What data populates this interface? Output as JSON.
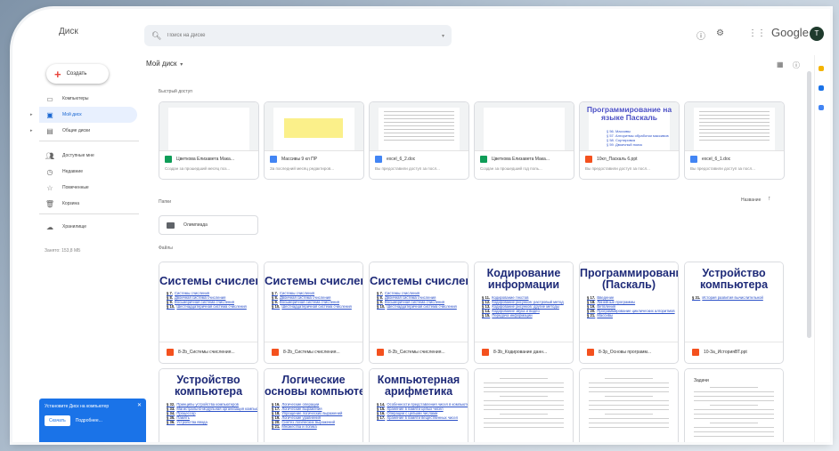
{
  "app": {
    "name": "Диск",
    "brand": "Google",
    "avatar_initial": "Т"
  },
  "search": {
    "placeholder": "Поиск на Диске"
  },
  "colors": {
    "accent": "#1a73e8",
    "active_bg": "#e8f0fe",
    "create_plus": "#e8453c"
  },
  "sidebar": {
    "create_label": "Создать",
    "items": [
      {
        "label": "Компьютеры",
        "icon": "devices-icon",
        "caret": false,
        "active": false
      },
      {
        "label": "Мой диск",
        "icon": "my-drive-icon",
        "caret": true,
        "active": true
      },
      {
        "label": "Общие диски",
        "icon": "shared-drives-icon",
        "caret": true,
        "active": false
      },
      {
        "label": "Доступные мне",
        "icon": "shared-with-me-icon",
        "caret": false,
        "active": false
      },
      {
        "label": "Недавние",
        "icon": "clock-icon",
        "caret": false,
        "active": false
      },
      {
        "label": "Помеченные",
        "icon": "star-icon",
        "caret": false,
        "active": false
      },
      {
        "label": "Корзина",
        "icon": "trash-icon",
        "caret": false,
        "active": false
      },
      {
        "label": "Хранилище",
        "icon": "cloud-icon",
        "caret": false,
        "active": false
      }
    ],
    "storage_text": "Занято: 153,8 МБ"
  },
  "install_banner": {
    "title": "Установите Диск на компьютер",
    "primary": "Скачать",
    "secondary": "Подробнее...",
    "close": "✕"
  },
  "main": {
    "breadcrumb": "Мой диск",
    "quick_access_label": "Быстрый доступ",
    "folders_label": "Папки",
    "files_label": "Файлы",
    "sort_label": "Название",
    "sort_arrow": "↑",
    "quick_access": [
      {
        "name": "Цветкова Елизавета Мака...",
        "sub": "Создан за прошедший месяц поз...",
        "type": "sheet",
        "thumb": "blank"
      },
      {
        "name": "Массивы 9 кл ПР",
        "sub": "За последний месяц редактиров...",
        "type": "doc",
        "thumb": "yellow"
      },
      {
        "name": "excel_6_2.doc",
        "sub": "Вы предоставили доступ за посл...",
        "type": "doc",
        "thumb": "lines"
      },
      {
        "name": "Цветкова Елизавета Мака...",
        "sub": "Создан за прошедший год поль...",
        "type": "sheet",
        "thumb": "blank"
      },
      {
        "name": "10кл_Паскаль 6.ppt",
        "sub": "Вы предоставили доступ за посл...",
        "type": "slide",
        "thumb": "pascal",
        "thumb_title": "Программирование на языке Паскаль",
        "thumb_links": [
          "§ 56. Массивы",
          "§ 57. Алгоритмы обработки массивов",
          "§ 58. Сортировка",
          "§ 59. Двоичный поиск"
        ]
      },
      {
        "name": "excel_6_1.doc",
        "sub": "Вы предоставили доступ за посл...",
        "type": "doc",
        "thumb": "lines"
      }
    ],
    "folders": [
      {
        "name": "Олимпиада"
      }
    ],
    "files": [
      {
        "title": "Системы счисления",
        "name": "8-2b_Системы счисления...",
        "type": "slide",
        "links": [
          [
            "§ 7.",
            "Системы счисления"
          ],
          [
            "§ 8.",
            "Двоичная система счисления"
          ],
          [
            "§ 9.",
            "Восьмеричная система счисления"
          ],
          [
            "§ 10.",
            "Шестнадцатеричная система счисления"
          ]
        ]
      },
      {
        "title": "Системы счисления",
        "name": "8-2b_Системы счисления...",
        "type": "slide",
        "links": [
          [
            "§ 7.",
            "Системы счисления"
          ],
          [
            "§ 8.",
            "Двоичная система счисления"
          ],
          [
            "§ 9.",
            "Восьмеричная система счисления"
          ],
          [
            "§ 10.",
            "Шестнадцатеричная система счисления"
          ]
        ]
      },
      {
        "title": "Системы счисления",
        "name": "8-2b_Системы счисления...",
        "type": "slide",
        "links": [
          [
            "§ 7.",
            "Системы счисления"
          ],
          [
            "§ 8.",
            "Двоичная система счисления"
          ],
          [
            "§ 9.",
            "Восьмеричная система счисления"
          ],
          [
            "§ 10.",
            "Шестнадцатеричная система счисления"
          ]
        ]
      },
      {
        "title": "Кодирование информации",
        "name": "8-3b_Кодирование данн...",
        "type": "slide",
        "links": [
          [
            "§ 11.",
            "Кодирование текстов"
          ],
          [
            "§ 12.",
            "Кодирование рисунков: растровый метод"
          ],
          [
            "§ 13.",
            "Кодирование рисунков: другие методы"
          ],
          [
            "§ 14.",
            "Кодирование звука и видео"
          ],
          [
            "§ 15.",
            "Передача информации"
          ]
        ]
      },
      {
        "title": "Программирование (Паскаль)",
        "name": "8-3p_Основы программ...",
        "type": "slide",
        "links": [
          [
            "§ 17.",
            "Введение"
          ],
          [
            "§ 18.",
            "Линейные программы"
          ],
          [
            "§ 19.",
            "Ветвления"
          ],
          [
            "§ 20.",
            "Программирование циклических алгоритмов"
          ],
          [
            "§ 21.",
            "Массивы"
          ]
        ]
      },
      {
        "title": "Устройство компьютера",
        "name": "10-3a_ИсторияВТ.ppt",
        "type": "slide",
        "links": [
          [
            "§ 31.",
            "История развития вычислительной"
          ]
        ]
      },
      {
        "title": "Устройство компьютера",
        "name": "",
        "type": "slide",
        "links": [
          [
            "§ 32.",
            "Принципы устройства компьютеров"
          ],
          [
            "§ 33.",
            "Магистрально-модульная организация компьютера"
          ],
          [
            "§ 34.",
            "Процессор"
          ],
          [
            "§ 35.",
            "Память"
          ],
          [
            "§ 36.",
            "Устройства ввода"
          ]
        ]
      },
      {
        "title": "Логические основы компьютеров",
        "name": "",
        "type": "slide",
        "links": [
          [
            "§ 16.",
            "Логические операции"
          ],
          [
            "§ 17.",
            "Логические выражения"
          ],
          [
            "§ 18.",
            "Упрощение логических выражений"
          ],
          [
            "§ 19.",
            "Логические уравнения"
          ],
          [
            "§ 20.",
            "Синтез логических выражений"
          ],
          [
            "§ 21.",
            "Множества и логика"
          ]
        ]
      },
      {
        "title": "Компьютерная арифметика",
        "name": "",
        "type": "slide",
        "links": [
          [
            "§ 14.",
            "Особенности представления чисел в компьютере"
          ],
          [
            "§ 15.",
            "Хранение в памяти целых чисел"
          ],
          [
            "§ 16.",
            "Операции с целыми числами"
          ],
          [
            "§ 17.",
            "Хранение в памяти вещественных чисел"
          ]
        ]
      },
      {
        "title": "",
        "name": "",
        "type": "doc",
        "links": []
      },
      {
        "title": "",
        "name": "",
        "type": "doc",
        "links": []
      },
      {
        "title": "Задачи",
        "name": "",
        "type": "doc",
        "links": []
      }
    ]
  }
}
